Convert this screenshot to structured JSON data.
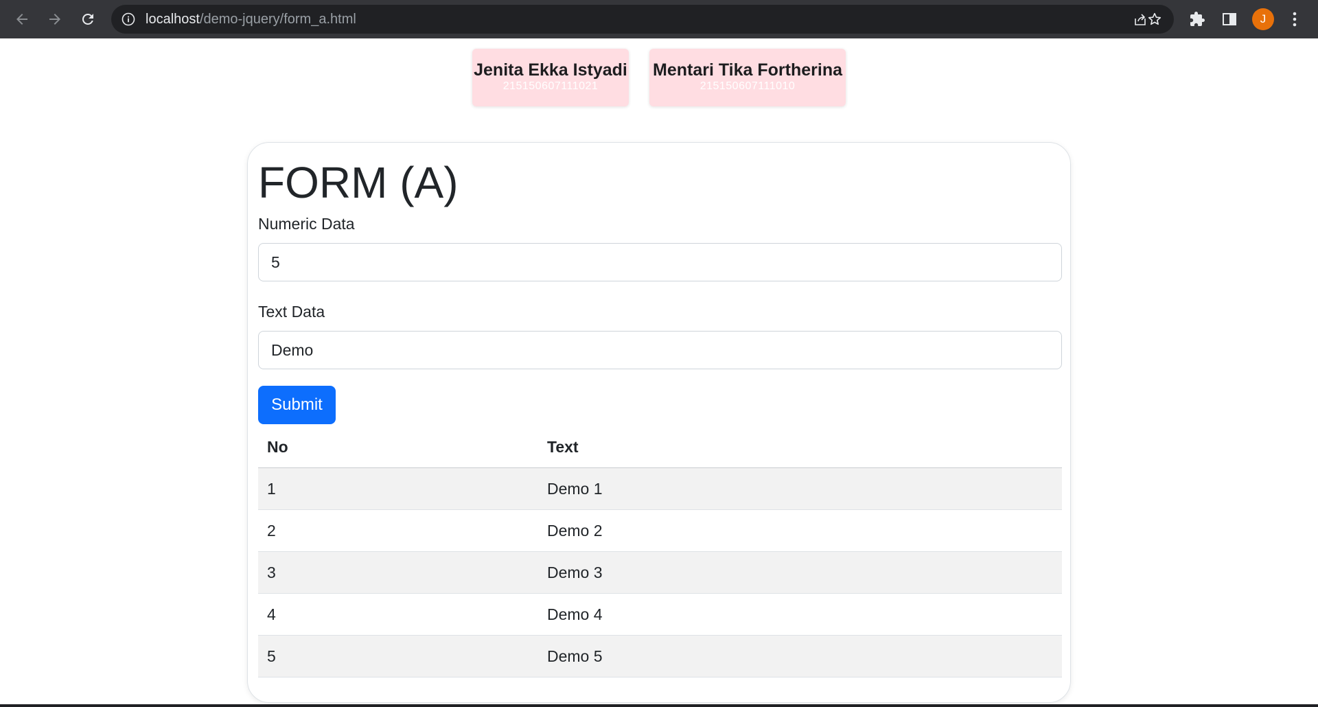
{
  "browser": {
    "url_host": "localhost",
    "url_path": "/demo-jquery/form_a.html",
    "profile_initial": "J",
    "icons": [
      "back-arrow-icon",
      "forward-arrow-icon",
      "reload-icon",
      "info-icon",
      "share-icon",
      "star-icon",
      "puzzle-icon",
      "side-panel-icon",
      "kebab-menu-icon"
    ]
  },
  "authors": [
    {
      "name": "Jenita Ekka Istyadi",
      "id": "215150607111021"
    },
    {
      "name": "Mentari Tika Fortherina",
      "id": "215150607111010"
    }
  ],
  "form": {
    "title": "FORM (A)",
    "numeric_label": "Numeric Data",
    "numeric_value": "5",
    "text_label": "Text Data",
    "text_value": "Demo",
    "submit_label": "Submit"
  },
  "table": {
    "headers": [
      "No",
      "Text"
    ],
    "rows": [
      {
        "no": "1",
        "text": "Demo 1"
      },
      {
        "no": "2",
        "text": "Demo 2"
      },
      {
        "no": "3",
        "text": "Demo 3"
      },
      {
        "no": "4",
        "text": "Demo 4"
      },
      {
        "no": "5",
        "text": "Demo 5"
      }
    ]
  },
  "colors": {
    "chrome_bg": "#35363a",
    "omnibox_bg": "#202124",
    "card_pink": "#ffdde2",
    "primary_button": "#0d6efd",
    "stripe": "#f2f2f2",
    "avatar": "#e8710a"
  }
}
